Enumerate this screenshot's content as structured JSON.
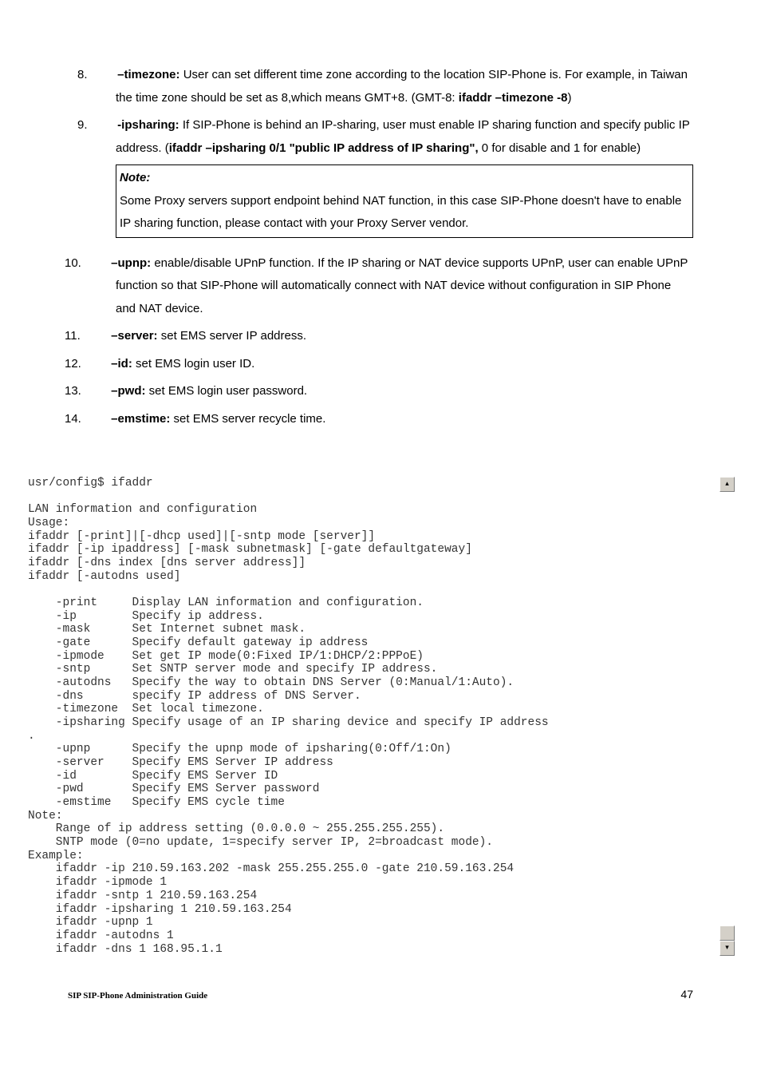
{
  "items": {
    "n8": "8.",
    "t8a": "–timezone:",
    "t8b": " User can set different time zone according to the location SIP-Phone is. For example, in Taiwan the time zone should be set as 8,which means GMT+8. (GMT-8: ",
    "t8c": "ifaddr –timezone -8",
    "t8d": ")",
    "n9": "9.",
    "t9a": "-ipsharing:",
    "t9b": " If SIP-Phone is behind an IP-sharing, user must enable IP sharing function and specify public IP address. (",
    "t9c": "ifaddr –ipsharing 0/1 \"public IP address of IP sharing\",",
    "t9d": " 0 for disable and 1 for enable)",
    "note_title": "Note:",
    "note_body": "Some Proxy servers support endpoint behind NAT function, in this case SIP-Phone doesn't have to enable IP sharing function, please contact with your Proxy Server vendor.",
    "n10": "10.",
    "t10a": "–upnp:",
    "t10b": " enable/disable UPnP function. If the IP sharing or NAT device supports UPnP, user can enable UPnP function so that SIP-Phone will automatically connect with NAT device without configuration in SIP Phone and NAT device.",
    "n11": "11.",
    "t11a": "–server:",
    "t11b": " set EMS server IP address.",
    "n12": "12.",
    "t12a": "–id:",
    "t12b": " set EMS login user ID.",
    "n13": "13.",
    "t13a": "–pwd:",
    "t13b": " set EMS login user password.",
    "n14": "14.",
    "t14a": "–emstime:",
    "t14b": " set EMS server recycle time."
  },
  "terminal": "usr/config$ ifaddr\n\nLAN information and configuration\nUsage:\nifaddr [-print]|[-dhcp used]|[-sntp mode [server]]\nifaddr [-ip ipaddress] [-mask subnetmask] [-gate defaultgateway]\nifaddr [-dns index [dns server address]]\nifaddr [-autodns used]\n\n    -print     Display LAN information and configuration.\n    -ip        Specify ip address.\n    -mask      Set Internet subnet mask.\n    -gate      Specify default gateway ip address\n    -ipmode    Set get IP mode(0:Fixed IP/1:DHCP/2:PPPoE)\n    -sntp      Set SNTP server mode and specify IP address.\n    -autodns   Specify the way to obtain DNS Server (0:Manual/1:Auto).\n    -dns       specify IP address of DNS Server.\n    -timezone  Set local timezone.\n    -ipsharing Specify usage of an IP sharing device and specify IP address\n.\n    -upnp      Specify the upnp mode of ipsharing(0:Off/1:On)\n    -server    Specify EMS Server IP address\n    -id        Specify EMS Server ID\n    -pwd       Specify EMS Server password\n    -emstime   Specify EMS cycle time\nNote:\n    Range of ip address setting (0.0.0.0 ~ 255.255.255.255).\n    SNTP mode (0=no update, 1=specify server IP, 2=broadcast mode).\nExample:\n    ifaddr -ip 210.59.163.202 -mask 255.255.255.0 -gate 210.59.163.254\n    ifaddr -ipmode 1\n    ifaddr -sntp 1 210.59.163.254\n    ifaddr -ipsharing 1 210.59.163.254\n    ifaddr -upnp 1\n    ifaddr -autodns 1\n    ifaddr -dns 1 168.95.1.1",
  "scroll": {
    "up": "▴",
    "down": "▾"
  },
  "footer": {
    "left": "SIP SIP-Phone   Administration Guide",
    "right": "47"
  }
}
